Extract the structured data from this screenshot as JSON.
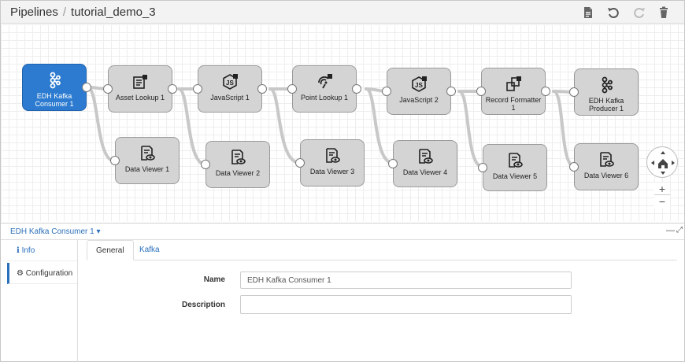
{
  "header": {
    "breadcrumb_root": "Pipelines",
    "breadcrumb_separator": "/",
    "pipeline_name": "tutorial_demo_3",
    "toolbar_icons": [
      "document-icon",
      "undo-icon",
      "redo-icon",
      "trash-icon"
    ]
  },
  "nodes": [
    {
      "label": "EDH Kafka Consumer 1",
      "icon": "kafka-icon",
      "selected": true
    },
    {
      "label": "Asset Lookup 1",
      "icon": "asset-lookup-icon"
    },
    {
      "label": "JavaScript 1",
      "icon": "javascript-icon"
    },
    {
      "label": "Point Lookup 1",
      "icon": "point-lookup-icon"
    },
    {
      "label": "JavaScript 2",
      "icon": "javascript-icon"
    },
    {
      "label": "Record Formatter 1",
      "icon": "record-formatter-icon"
    },
    {
      "label": "EDH Kafka Producer 1",
      "icon": "kafka-icon"
    },
    {
      "label": "Data Viewer 1",
      "icon": "data-viewer-icon"
    },
    {
      "label": "Data Viewer 2",
      "icon": "data-viewer-icon"
    },
    {
      "label": "Data Viewer 3",
      "icon": "data-viewer-icon"
    },
    {
      "label": "Data Viewer 4",
      "icon": "data-viewer-icon"
    },
    {
      "label": "Data Viewer 5",
      "icon": "data-viewer-icon"
    },
    {
      "label": "Data Viewer 6",
      "icon": "data-viewer-icon"
    }
  ],
  "zoom": {
    "in_label": "+",
    "out_label": "−"
  },
  "panel": {
    "title": "EDH Kafka Consumer 1",
    "sidebar": [
      {
        "label": "Info",
        "icon": "info-icon"
      },
      {
        "label": "Configuration",
        "icon": "gear-icon"
      }
    ],
    "tabs": [
      "General",
      "Kafka"
    ],
    "active_tab": "General",
    "form": {
      "name_label": "Name",
      "name_value": "EDH Kafka Consumer 1",
      "description_label": "Description",
      "description_value": ""
    }
  },
  "colors": {
    "selected_node": "#2c7bd0",
    "node": "#d4d4d4",
    "link": "#2a6fba"
  }
}
